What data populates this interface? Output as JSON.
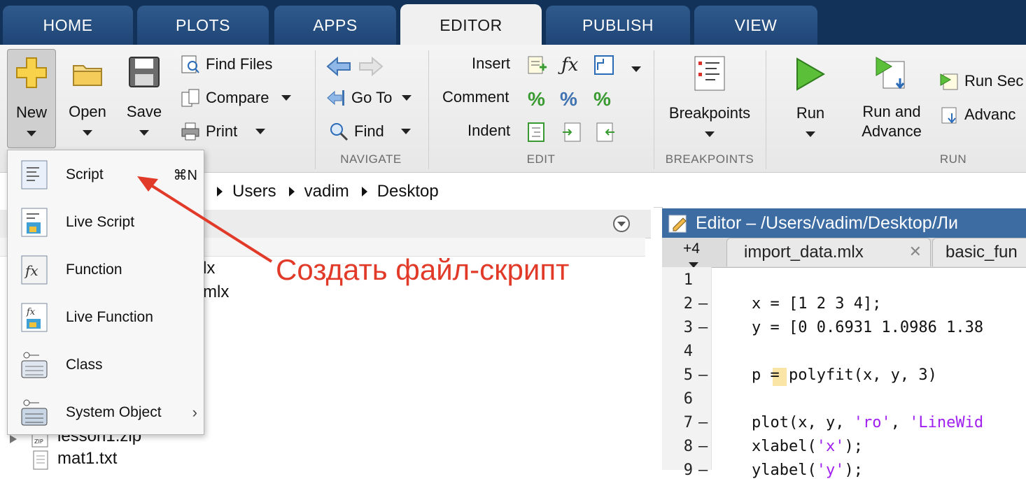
{
  "tabs": [
    "HOME",
    "PLOTS",
    "APPS",
    "EDITOR",
    "PUBLISH",
    "VIEW"
  ],
  "ribbon": {
    "file": {
      "new": "New",
      "open": "Open",
      "save": "Save",
      "find_files": "Find Files",
      "compare": "Compare",
      "print": "Print"
    },
    "navigate": {
      "goto": "Go To",
      "find": "Find",
      "group": "NAVIGATE"
    },
    "edit": {
      "insert": "Insert",
      "comment": "Comment",
      "indent": "Indent",
      "group": "EDIT"
    },
    "breakpoints": {
      "label": "Breakpoints",
      "group": "BREAKPOINTS"
    },
    "run": {
      "run": "Run",
      "run_advance_1": "Run and",
      "run_advance_2": "Advance",
      "run_section": "Run Sec",
      "advance": "Advanc",
      "group": "RUN"
    }
  },
  "address": {
    "crumbs": [
      "Users",
      "vadim",
      "Desktop"
    ]
  },
  "files": {
    "partial1": "lx",
    "partial2": "mlx",
    "zip": "lesson1.zip",
    "txt": "mat1.txt"
  },
  "menu": {
    "items": [
      {
        "label": "Script",
        "shortcut": "⌘N",
        "icon": "script-icon"
      },
      {
        "label": "Live Script",
        "icon": "live-script-icon"
      },
      {
        "label": "Function",
        "icon": "function-icon"
      },
      {
        "label": "Live Function",
        "icon": "live-function-icon"
      },
      {
        "label": "Class",
        "icon": "class-icon"
      },
      {
        "label": "System Object",
        "icon": "system-object-icon"
      }
    ]
  },
  "annotation": "Создать файл-скрипт",
  "editor": {
    "title": "Editor – /Users/vadim/Desktop/Ли",
    "more_tabs": "+4",
    "tabs": [
      "import_data.mlx",
      "basic_fun"
    ],
    "lines": [
      {
        "n": "1",
        "code": ""
      },
      {
        "n": "2",
        "code": "x = [1 2 3 4];"
      },
      {
        "n": "3",
        "code": "y = [0 0.6931 1.0986 1.38"
      },
      {
        "n": "4",
        "code": ""
      },
      {
        "n": "5",
        "code": "p = polyfit(x, y, 3)"
      },
      {
        "n": "6",
        "code": ""
      },
      {
        "n": "7",
        "code_a": "plot(x, y, ",
        "code_s1": "'ro'",
        "code_b": ", ",
        "code_s2": "'LineWid"
      },
      {
        "n": "8",
        "code_a": "xlabel(",
        "code_s1": "'x'",
        "code_b": ");"
      },
      {
        "n": "9",
        "code_a": "ylabel(",
        "code_s1": "'y'",
        "code_b": ");"
      }
    ]
  },
  "colors": {
    "tabbar": "#13325a",
    "tab": "#2f5a8c",
    "editor_title": "#3d6ca3",
    "annotation": "#e13a29",
    "string": "#a020f0"
  }
}
